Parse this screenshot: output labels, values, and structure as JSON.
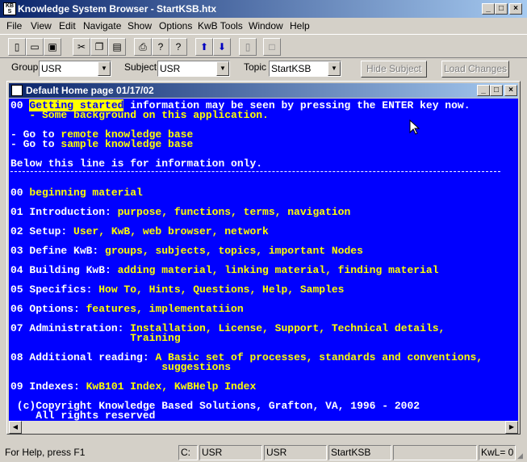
{
  "app": {
    "title": "Knowledge System Browser - StartKSB.htx",
    "icon_text": "KB S"
  },
  "menu": [
    "File",
    "View",
    "Edit",
    "Navigate",
    "Show",
    "Options",
    "KwB Tools",
    "Window",
    "Help"
  ],
  "toolbar": {
    "icons": [
      "new-icon",
      "open-icon",
      "save-icon",
      "cut-icon",
      "copy-icon",
      "paste-icon",
      "print-icon",
      "help-icon",
      "context-help-icon",
      "up-arrow-icon",
      "down-arrow-icon",
      "page-icon",
      "blank-page-icon"
    ]
  },
  "selectors": {
    "group_label": "Group",
    "group_value": "USR",
    "subject_label": "Subject",
    "subject_value": "USR",
    "topic_label": "Topic",
    "topic_value": "StartKSB",
    "hide_subject": "Hide Subject",
    "load_changes": "Load Changes"
  },
  "doc": {
    "title": "Default Home page 01/17/02",
    "lines": [
      {
        "w": "00 ",
        "hl": "Getting started",
        "w2": " information may be seen by pressing the ENTER key now."
      },
      {
        "w": "   - Some background on this application."
      },
      {
        "w": "- Go to ",
        "y": "remote knowledge base"
      },
      {
        "w": "- Go to ",
        "y": "sample knowledge base"
      },
      {
        "w": "Below this line is for information only."
      },
      {
        "w": "00 ",
        "y": "beginning material"
      },
      {
        "w": "01 Introduction: ",
        "y": "purpose, functions, terms, navigation"
      },
      {
        "w": "02 Setup: ",
        "y": "User, KwB, web browser, network"
      },
      {
        "w": "03 Define KwB: ",
        "y": "groups, subjects, topics, important Nodes"
      },
      {
        "w": "04 Building KwB: ",
        "y": "adding material, linking material, finding material"
      },
      {
        "w": "05 Specifics: ",
        "y": "How To, Hints, Questions, Help, Samples"
      },
      {
        "w": "06 Options: ",
        "y": "features, implementatiion"
      },
      {
        "w": "07 Administration: ",
        "y": "Installation, License, Support, Technical details,"
      },
      {
        "y": "                   Training"
      },
      {
        "w": "08 Additional reading: ",
        "y": "A Basic set of processes, standards and conventions,"
      },
      {
        "y": "                        suggestions"
      },
      {
        "w": "09 Indexes: ",
        "y": "KwB101 Index, KwBHelp Index"
      },
      {
        "w": " (c)Copyright Knowledge Based Solutions, Grafton, VA, 1996 - 2002"
      },
      {
        "w": "    All rights reserved"
      }
    ]
  },
  "status": {
    "help": "For Help, press F1",
    "drive": "C:",
    "group": "USR",
    "subject": "USR",
    "topic": "StartKSB",
    "kwl": "KwL= 0"
  }
}
